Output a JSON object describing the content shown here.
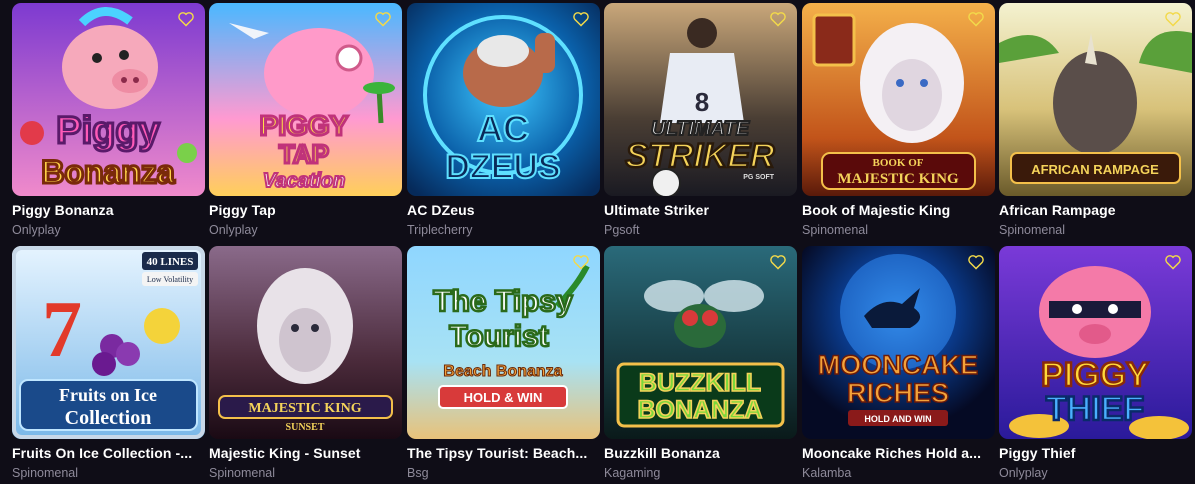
{
  "games": [
    {
      "title": "Piggy Bonanza",
      "provider": "Onlyplay",
      "logo_text": [
        "Piggy",
        "Bonanza"
      ],
      "bg": [
        "#8a3fd1",
        "#f07ac4"
      ],
      "icon": "heart-outline-icon"
    },
    {
      "title": "Piggy Tap",
      "provider": "Onlyplay",
      "logo_text": [
        "PIGGY",
        "TAP",
        "Vacation"
      ],
      "bg": [
        "#3fb3ff",
        "#ffd36b"
      ],
      "icon": "heart-outline-icon"
    },
    {
      "title": "AC DZeus",
      "provider": "Triplecherry",
      "logo_text": [
        "AC",
        "DZEUS"
      ],
      "bg": [
        "#0a3f78",
        "#22a7e6"
      ],
      "icon": "heart-outline-icon"
    },
    {
      "title": "Ultimate Striker",
      "provider": "Pgsoft",
      "logo_text": [
        "ULTIMATE",
        "STRIKER",
        "PG SOFT"
      ],
      "bg": [
        "#7e6d58",
        "#2a2e3a"
      ],
      "icon": "heart-outline-icon"
    },
    {
      "title": "Book of Majestic King",
      "provider": "Spinomenal",
      "logo_text": [
        "BOOK OF",
        "MAJESTIC KING"
      ],
      "bg": [
        "#f0a53a",
        "#8a2a12"
      ],
      "icon": "heart-outline-icon"
    },
    {
      "title": "African Rampage",
      "provider": "Spinomenal",
      "logo_text": [
        "AFRICAN RAMPAGE"
      ],
      "bg": [
        "#d9d7a8",
        "#7a6a3a"
      ],
      "icon": "heart-outline-icon"
    },
    {
      "title": "Fruits On Ice Collection -...",
      "provider": "Spinomenal",
      "logo_text": [
        "40 LINES",
        "Low Volatility",
        "Fruits on Ice",
        "Collection"
      ],
      "bg": [
        "#bfe6ff",
        "#2a6fb5"
      ],
      "icon": "heart-outline-icon"
    },
    {
      "title": "Majestic King - Sunset",
      "provider": "Spinomenal",
      "logo_text": [
        "MAJESTIC KING",
        "SUNSET"
      ],
      "bg": [
        "#6a4a7a",
        "#2a1a2a"
      ],
      "icon": "heart-outline-icon"
    },
    {
      "title": "The Tipsy Tourist: Beach...",
      "provider": "Bsg",
      "logo_text": [
        "The Tipsy",
        "Tourist",
        "Beach Bonanza",
        "HOLD & WIN"
      ],
      "bg": [
        "#8fd6ff",
        "#e8c27a"
      ],
      "icon": "heart-outline-icon"
    },
    {
      "title": "Buzzkill Bonanza",
      "provider": "Kagaming",
      "logo_text": [
        "BUZZKILL",
        "BONANZA"
      ],
      "bg": [
        "#1f5b6b",
        "#0f2a2a"
      ],
      "icon": "heart-outline-icon"
    },
    {
      "title": "Mooncake Riches Hold a...",
      "provider": "Kalamba",
      "logo_text": [
        "MOONCAKE",
        "RICHES",
        "HOLD AND WIN"
      ],
      "bg": [
        "#0b2a6a",
        "#050a24"
      ],
      "icon": "heart-outline-icon"
    },
    {
      "title": "Piggy Thief",
      "provider": "Onlyplay",
      "logo_text": [
        "PIGGY",
        "THIEF"
      ],
      "bg": [
        "#6a2ac9",
        "#2a1aa0"
      ],
      "icon": "heart-outline-icon"
    }
  ]
}
